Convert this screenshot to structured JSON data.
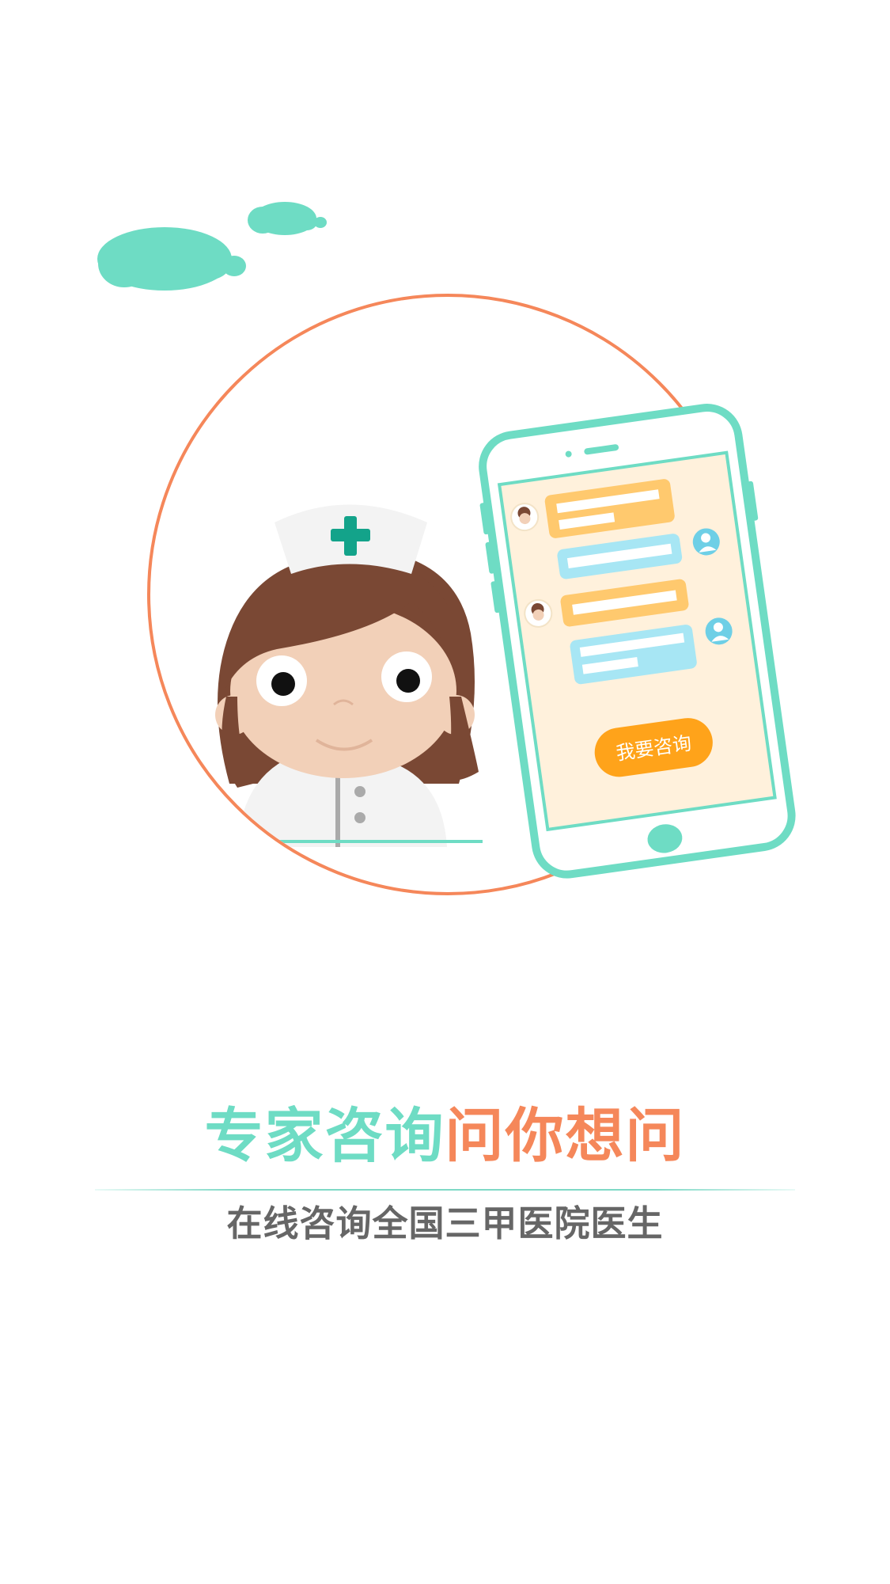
{
  "headline": {
    "part1": "专家咨询",
    "part2": "问你想问"
  },
  "subtitle": "在线咨询全国三甲医院医生",
  "phone": {
    "consult_button_label": "我要咨询"
  },
  "colors": {
    "teal": "#6edcc4",
    "orange": "#f5875a",
    "button_orange": "#ffa31a",
    "text_gray": "#666666"
  }
}
